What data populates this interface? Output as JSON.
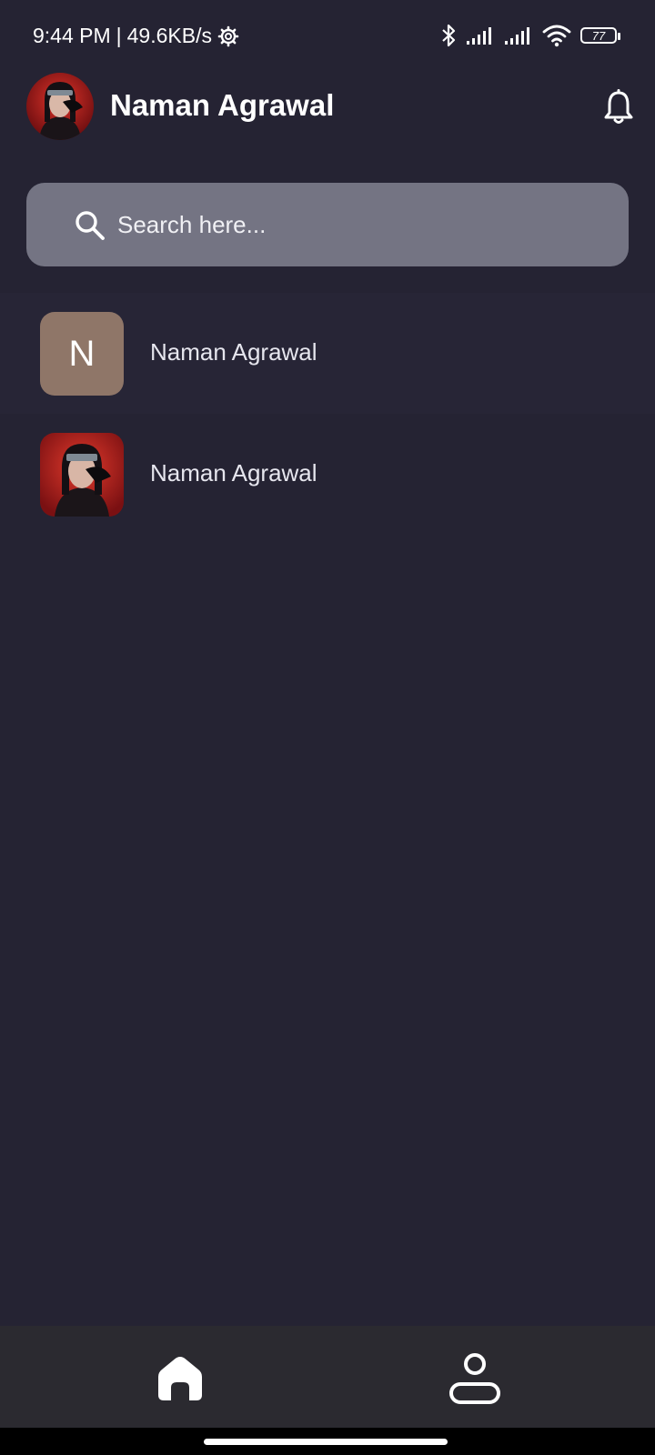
{
  "status_bar": {
    "time": "9:44 PM",
    "separator": "|",
    "network_speed": "49.6KB/s",
    "battery_level": "77",
    "icons": [
      "settings-gear-icon",
      "bluetooth-icon",
      "signal-icon",
      "signal-icon",
      "wifi-icon",
      "battery-icon"
    ]
  },
  "header": {
    "user_name": "Naman Agrawal",
    "avatar": "user-avatar",
    "notification_icon": "bell-icon"
  },
  "search": {
    "placeholder": "Search here...",
    "value": "",
    "icon": "search-icon"
  },
  "contacts": [
    {
      "name": "Naman Agrawal",
      "avatar_type": "letter",
      "initial": "N"
    },
    {
      "name": "Naman Agrawal",
      "avatar_type": "photo"
    }
  ],
  "bottom_nav": {
    "items": [
      {
        "icon": "home-icon",
        "active": true
      },
      {
        "icon": "profile-icon",
        "active": false
      }
    ]
  },
  "colors": {
    "background": "#252333",
    "search_background": "#747483",
    "letter_avatar": "#8f7668",
    "bottom_nav": "#2b2a30",
    "text": "#ffffff"
  }
}
